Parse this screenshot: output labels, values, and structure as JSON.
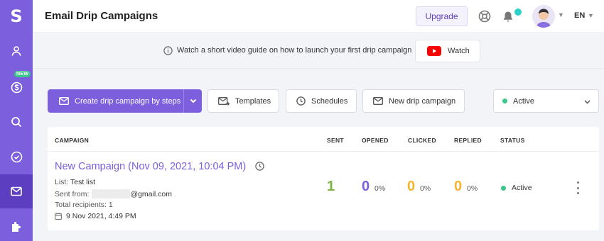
{
  "app": {
    "logo_letter": "S"
  },
  "sidebar": {
    "new_badge": "NEW",
    "items": [
      {
        "icon": "user-icon"
      },
      {
        "icon": "dollar-icon"
      },
      {
        "icon": "search-icon"
      },
      {
        "icon": "check-circle-icon"
      },
      {
        "icon": "mail-icon",
        "active": true
      },
      {
        "icon": "puzzle-icon"
      }
    ]
  },
  "header": {
    "title": "Email Drip Campaigns",
    "upgrade_label": "Upgrade",
    "language": "EN"
  },
  "banner": {
    "text": "Watch a short video guide on how to launch your first drip campaign",
    "watch_label": "Watch"
  },
  "toolbar": {
    "create_label": "Create drip campaign by steps",
    "templates_label": "Templates",
    "schedules_label": "Schedules",
    "new_label": "New drip campaign",
    "status_filter": "Active"
  },
  "table": {
    "headers": {
      "campaign": "CAMPAIGN",
      "sent": "SENT",
      "opened": "OPENED",
      "clicked": "CLICKED",
      "replied": "REPLIED",
      "status": "STATUS"
    },
    "rows": [
      {
        "name": "New Campaign (Nov 09, 2021, 10:04 PM)",
        "list_label": "List:",
        "list_value": "Test list",
        "sent_from_label": "Sent from:",
        "sent_from_domain": "@gmail.com",
        "recipients_label": "Total recipients:",
        "recipients_value": "1",
        "date": "9 Nov 2021, 4:49 PM",
        "sent": "1",
        "opened": "0",
        "opened_pct": "0%",
        "clicked": "0",
        "clicked_pct": "0%",
        "replied": "0",
        "replied_pct": "0%",
        "status": "Active"
      }
    ]
  },
  "colors": {
    "brand": "#7b5fdc",
    "sidebar_active": "#5b3fc0",
    "green": "#3cc68a",
    "sent": "#7cb342",
    "opened": "#7b5fdc",
    "clicked": "#f5b52e",
    "replied": "#f5b52e"
  }
}
